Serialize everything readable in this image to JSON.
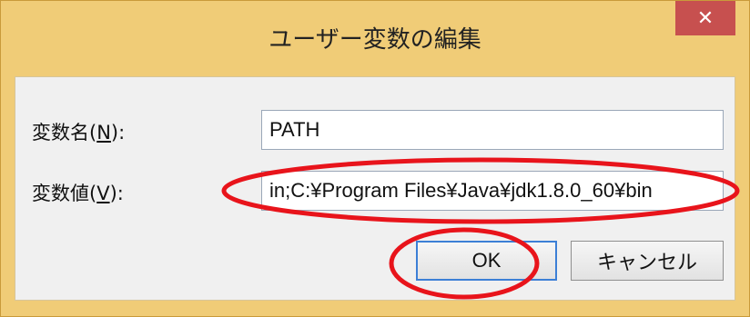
{
  "window": {
    "title": "ユーザー変数の編集",
    "close_glyph": "✕"
  },
  "form": {
    "name_label": "変数名(",
    "name_accel": "N",
    "name_label_end": "):",
    "name_value": "PATH",
    "value_label": "変数値(",
    "value_accel": "V",
    "value_label_end": "):",
    "value_value": "in;C:¥Program Files¥Java¥jdk1.8.0_60¥bin"
  },
  "buttons": {
    "ok_label": "OK",
    "cancel_label": "キャンセル"
  },
  "colors": {
    "titlebar": "#f0cc77",
    "close_button": "#c7504f",
    "annotation": "#e8141b"
  },
  "icons": [
    "close-icon"
  ]
}
